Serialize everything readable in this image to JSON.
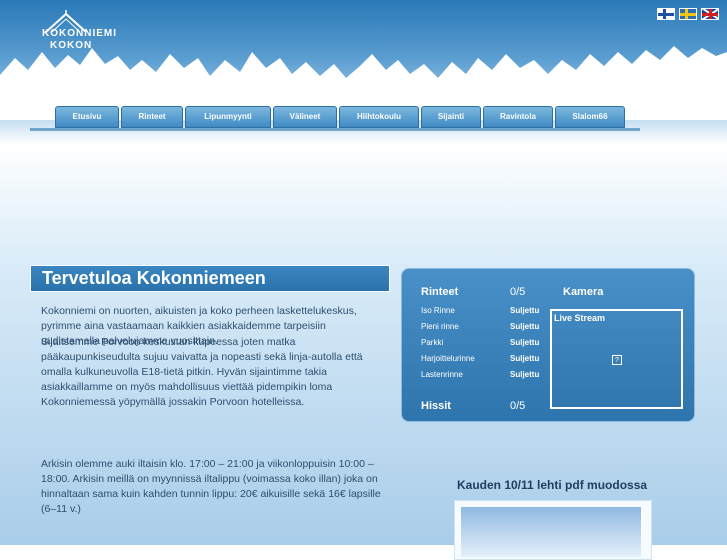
{
  "header": {
    "logo_line1": "KOKONNIEMI",
    "logo_line2": "KOKON",
    "flags": [
      {
        "name": "finnish-flag"
      },
      {
        "name": "swedish-flag"
      },
      {
        "name": "english-flag"
      }
    ]
  },
  "nav": {
    "items": [
      "Etusivu",
      "Rinteet",
      "Lipunmyynti",
      "Välineet",
      "Hiihtokoulu",
      "Sijainti",
      "Ravintola",
      "Slalom66"
    ]
  },
  "main": {
    "title": "Tervetuloa Kokonniemeen",
    "p1": "Kokonniemi on nuorten, aikuisten ja koko perheen laskettelukeskus, pyrimme aina vastaamaan kaikkien asiakkaidemme tarpeisiin uudistamalla palvelujamme vuosittain.",
    "p2": "Sijaitsemme Porvoon keskustan kupeessa joten matka pääkaupunkiseudulta sujuu vaivatta ja nopeasti sekä linja-autolla että omalla kulkuneuvolla E18-tietä pitkin. Hyvän sijaintimme takia asiakkaillamme on myös mahdollisuus viettää pidempikin loma Kokonniemessä yöpymällä jossakin Porvoon hotelleissa.",
    "p3": "Arkisin olemme auki iltaisin klo. 17:00 – 21:00 ja viikonloppuisin 10:00 – 18:00. Arkisin meillä on myynnissä iltalippu (voimassa koko illan) joka on hinnaltaan sama kuin kahden tunnin lippu: 20€ aikuisille sekä 16€ lapsille (6–11 v.)"
  },
  "status_panel": {
    "slopes_title": "Rinteet",
    "slopes_count": "0/5",
    "slopes": [
      {
        "name": "Iso Rinne",
        "status": "Suljettu"
      },
      {
        "name": "Pieni rinne",
        "status": "Suljettu"
      },
      {
        "name": "Parkki",
        "status": "Suljettu"
      },
      {
        "name": "Harjoittelurinne",
        "status": "Suljettu"
      },
      {
        "name": "Lastenrinne",
        "status": "Suljettu"
      }
    ],
    "lifts_title": "Hissit",
    "lifts_count": "0/5",
    "camera_title": "Kamera",
    "live_stream_label": "Live Stream",
    "placeholder_glyph": "?"
  },
  "magazine": {
    "title": "Kauden 10/11 lehti pdf muodossa"
  }
}
